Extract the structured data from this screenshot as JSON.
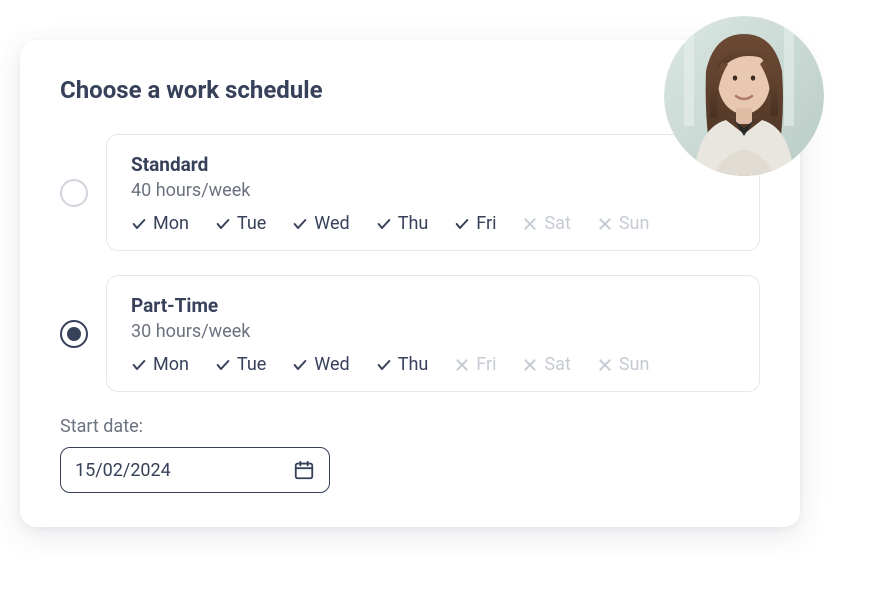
{
  "heading": "Choose a work schedule",
  "options": [
    {
      "title": "Standard",
      "subtitle": "40 hours/week",
      "selected": false,
      "days": [
        {
          "label": "Mon",
          "working": true
        },
        {
          "label": "Tue",
          "working": true
        },
        {
          "label": "Wed",
          "working": true
        },
        {
          "label": "Thu",
          "working": true
        },
        {
          "label": "Fri",
          "working": true
        },
        {
          "label": "Sat",
          "working": false
        },
        {
          "label": "Sun",
          "working": false
        }
      ]
    },
    {
      "title": "Part-Time",
      "subtitle": "30 hours/week",
      "selected": true,
      "days": [
        {
          "label": "Mon",
          "working": true
        },
        {
          "label": "Tue",
          "working": true
        },
        {
          "label": "Wed",
          "working": true
        },
        {
          "label": "Thu",
          "working": true
        },
        {
          "label": "Fri",
          "working": false
        },
        {
          "label": "Sat",
          "working": false
        },
        {
          "label": "Sun",
          "working": false
        }
      ]
    }
  ],
  "startDate": {
    "label": "Start date:",
    "value": "15/02/2024"
  }
}
